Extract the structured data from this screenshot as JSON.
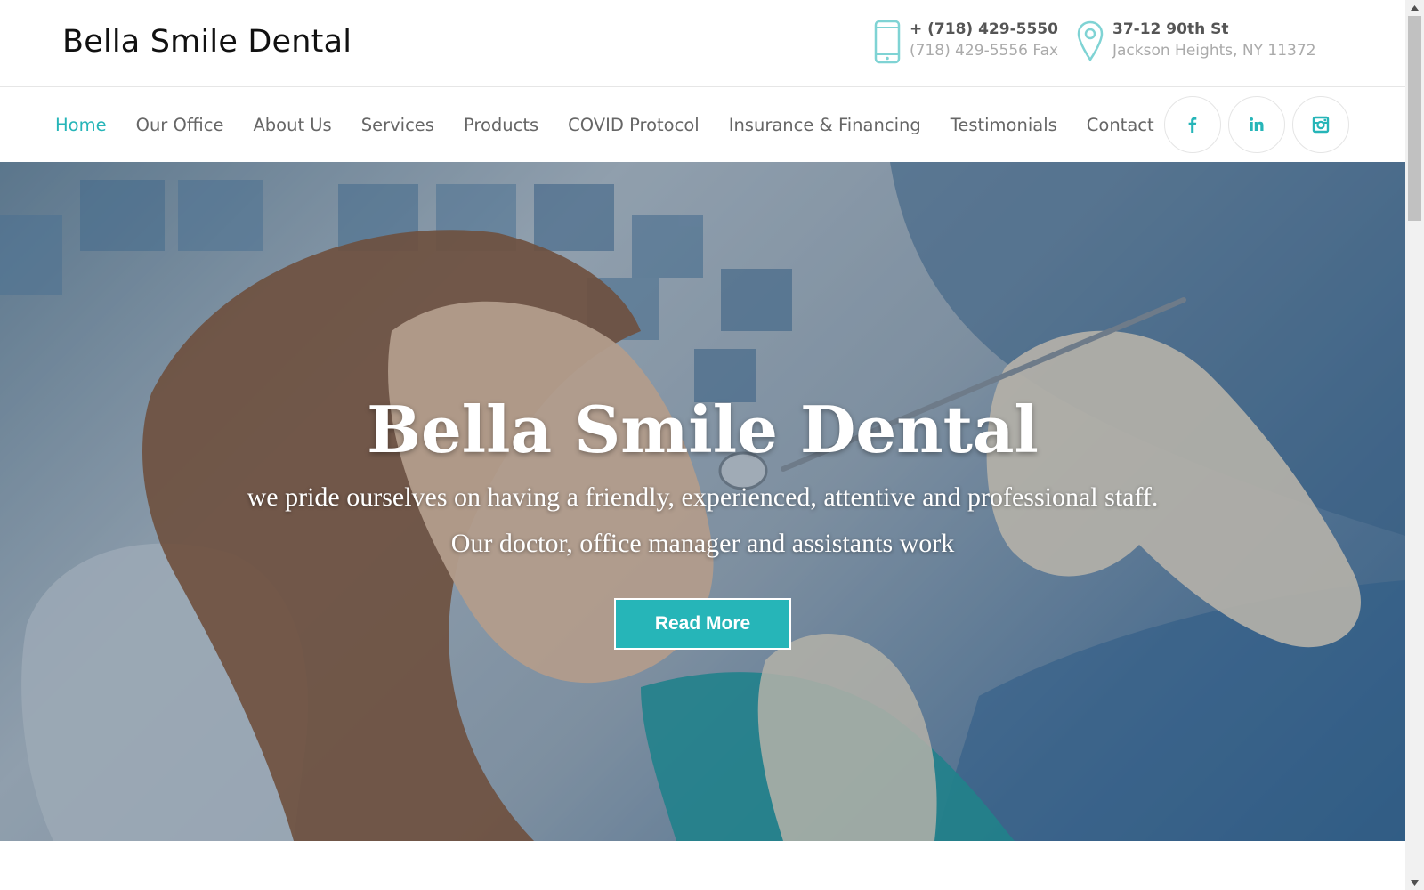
{
  "header": {
    "logo": "Bella Smile Dental",
    "phone": {
      "icon": "phone-icon",
      "main": "+ (718) 429-5550",
      "fax": "(718) 429-5556 Fax"
    },
    "address": {
      "icon": "location-pin-icon",
      "street": "37-12 90th St",
      "city": "Jackson Heights, NY 11372"
    }
  },
  "nav": {
    "items": [
      {
        "label": "Home",
        "active": true
      },
      {
        "label": "Our Office"
      },
      {
        "label": "About Us"
      },
      {
        "label": "Services"
      },
      {
        "label": "Products"
      },
      {
        "label": "COVID Protocol"
      },
      {
        "label": "Insurance & Financing"
      },
      {
        "label": "Testimonials"
      },
      {
        "label": "Contact"
      }
    ],
    "social": [
      {
        "icon": "facebook-icon"
      },
      {
        "icon": "linkedin-icon"
      },
      {
        "icon": "instagram-icon"
      }
    ]
  },
  "hero": {
    "title": "Bella Smile Dental",
    "subtitle_line1": "we pride ourselves on having a friendly, experienced, attentive and professional staff.",
    "subtitle_line2": "Our doctor, office manager and assistants work",
    "button_label": "Read More"
  },
  "colors": {
    "accent": "#26b5b8",
    "nav_text": "#666666",
    "heading": "#111111"
  }
}
